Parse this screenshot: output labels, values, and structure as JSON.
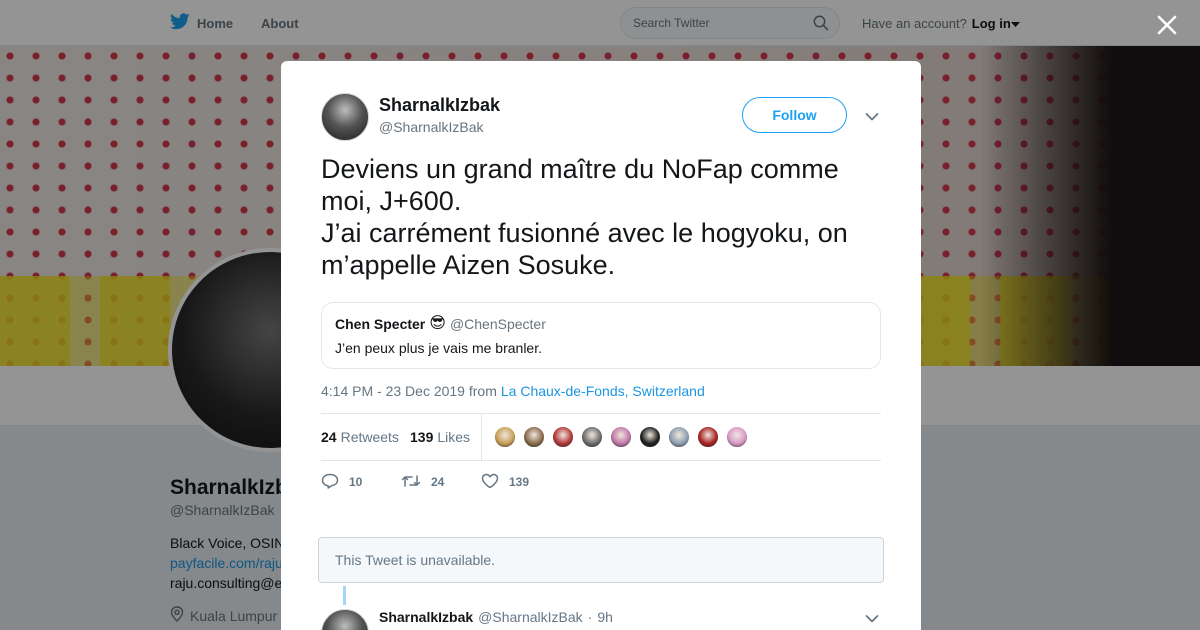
{
  "topbar": {
    "home_label": "Home",
    "about_label": "About",
    "search_placeholder": "Search Twitter",
    "have_account": "Have an account?",
    "login_label": "Log in"
  },
  "profile": {
    "name": "SharnalkIzbak",
    "handle": "@SharnalkIzBak",
    "bio_visible": "Black Voice, OSIN",
    "link_visible": "payfacile.com/raju",
    "email_visible": "raju.consulting@e",
    "location_visible": "Kuala Lumpur"
  },
  "tweet": {
    "author_name": "SharnalkIzbak",
    "author_handle": "@SharnalkIzBak",
    "follow_label": "Follow",
    "text_lines": [
      "Deviens un grand maître du NoFap comme moi, J+600.",
      "J’ai carrément fusionné avec le hogyoku, on m’appelle Aizen Sosuke."
    ],
    "quote": {
      "name": "Chen Specter",
      "emoji": "😎",
      "handle": "@ChenSpecter",
      "text": "J’en peux plus je vais me branler."
    },
    "timestamp": "4:14 PM - 23 Dec 2019 from",
    "location": "La Chaux-de-Fonds, Switzerland",
    "retweets_count": "24",
    "retweets_label": "Retweets",
    "likes_count": "139",
    "likes_label": "Likes",
    "liker_colors": [
      "#c9a15a",
      "#8a6d4e",
      "#b23a3a",
      "#6e6e6e",
      "#c07aa8",
      "#222222",
      "#8da0b3",
      "#a82424",
      "#d99ac6"
    ],
    "actions": {
      "reply_count": "10",
      "retweet_count": "24",
      "like_count": "139"
    }
  },
  "thread": {
    "unavailable_text": "This Tweet is unavailable.",
    "reply": {
      "name": "SharnalkIzbak",
      "handle": "@SharnalkIzBak",
      "separator": "·",
      "time": "9h"
    }
  },
  "colors": {
    "twitter_blue": "#1da1f2",
    "link_blue": "#1b95e0",
    "gray_text": "#657786"
  }
}
